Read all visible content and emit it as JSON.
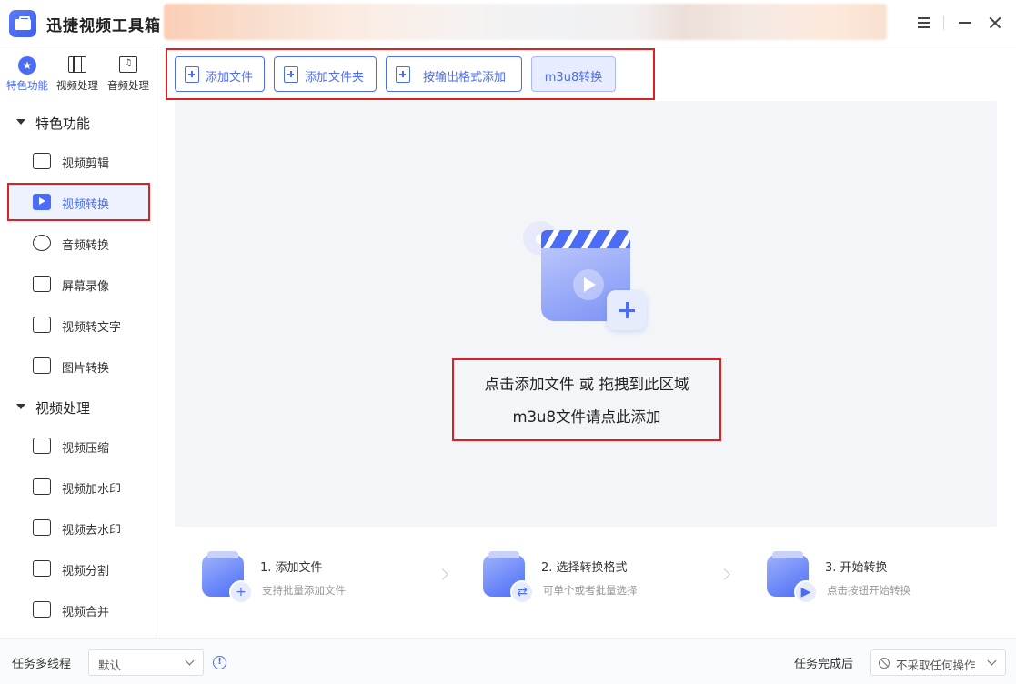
{
  "app": {
    "title": "迅捷视频工具箱"
  },
  "categories": [
    {
      "label": "特色功能",
      "icon": "star-icon"
    },
    {
      "label": "视频处理",
      "icon": "film-icon"
    },
    {
      "label": "音频处理",
      "icon": "music-icon"
    }
  ],
  "sidebar": {
    "groups": [
      {
        "title": "特色功能",
        "items": [
          {
            "label": "视频剪辑",
            "icon": "crop-icon"
          },
          {
            "label": "视频转换",
            "icon": "video-convert-icon",
            "active": true
          },
          {
            "label": "音频转换",
            "icon": "audio-wave-icon"
          },
          {
            "label": "屏幕录像",
            "icon": "screen-record-icon"
          },
          {
            "label": "视频转文字",
            "icon": "video-to-text-icon"
          },
          {
            "label": "图片转换",
            "icon": "image-icon"
          }
        ]
      },
      {
        "title": "视频处理",
        "items": [
          {
            "label": "视频压缩",
            "icon": "compress-icon"
          },
          {
            "label": "视频加水印",
            "icon": "add-watermark-icon"
          },
          {
            "label": "视频去水印",
            "icon": "remove-watermark-icon"
          },
          {
            "label": "视频分割",
            "icon": "split-icon"
          },
          {
            "label": "视频合并",
            "icon": "merge-icon"
          }
        ]
      }
    ]
  },
  "toolbar": {
    "add_file": "添加文件",
    "add_folder": "添加文件夹",
    "add_by_format": "按输出格式添加",
    "m3u8": "m3u8转换"
  },
  "dropzone": {
    "line1": "点击添加文件 或 拖拽到此区域",
    "line2": "m3u8文件请点此添加"
  },
  "steps": [
    {
      "title": "1. 添加文件",
      "desc": "支持批量添加文件"
    },
    {
      "title": "2. 选择转换格式",
      "desc": "可单个或者批量选择"
    },
    {
      "title": "3. 开始转换",
      "desc": "点击按钮开始转换"
    }
  ],
  "footer": {
    "multithread_label": "任务多线程",
    "multithread_value": "默认",
    "after_label": "任务完成后",
    "after_value": "不采取任何操作"
  },
  "colors": {
    "accent": "#4a6cf7",
    "highlight_border": "#e02020"
  }
}
